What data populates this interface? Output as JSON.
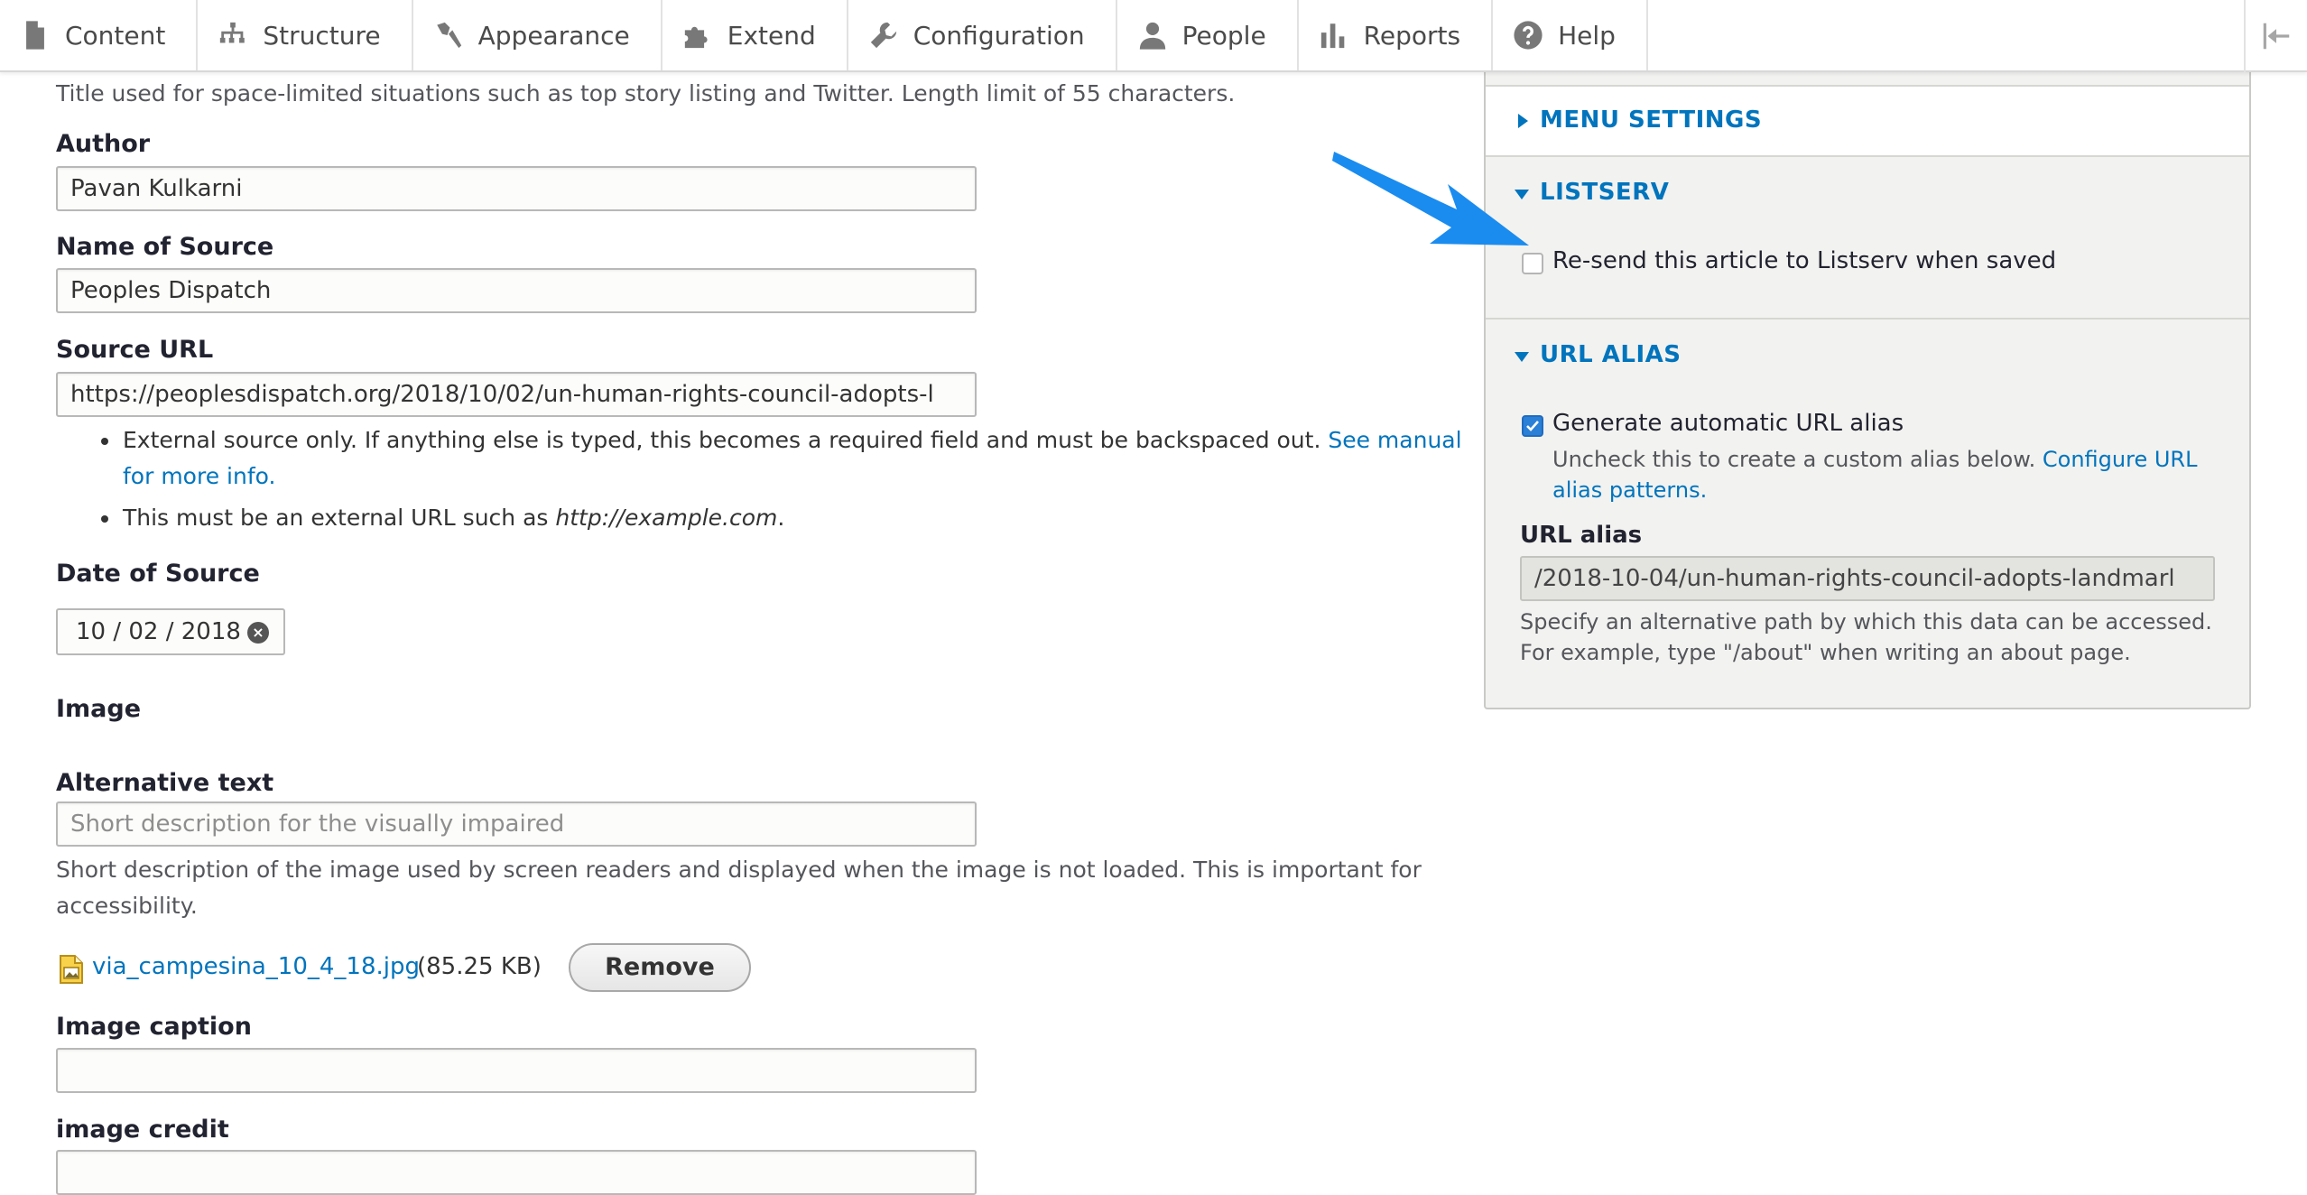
{
  "toolbar": {
    "items": [
      {
        "label": "Content",
        "icon": "document-icon"
      },
      {
        "label": "Structure",
        "icon": "sitemap-icon"
      },
      {
        "label": "Appearance",
        "icon": "paintbrush-icon"
      },
      {
        "label": "Extend",
        "icon": "puzzle-icon"
      },
      {
        "label": "Configuration",
        "icon": "wrench-icon"
      },
      {
        "label": "People",
        "icon": "person-icon"
      },
      {
        "label": "Reports",
        "icon": "bar-chart-icon"
      },
      {
        "label": "Help",
        "icon": "help-icon"
      }
    ]
  },
  "form": {
    "short_title_description": "Title used for space-limited situations such as top story listing and Twitter. Length limit of 55 characters.",
    "author": {
      "label": "Author",
      "value": "Pavan Kulkarni"
    },
    "source_name": {
      "label": "Name of Source",
      "value": "Peoples Dispatch"
    },
    "source_url": {
      "label": "Source URL",
      "value": "https://peoplesdispatch.org/2018/10/02/un-human-rights-council-adopts-l",
      "help_1_text": "External source only. If anything else is typed, this becomes a required field and must be backspaced out.",
      "help_1_link_a": "See manual",
      "help_1_link_b": "for more info.",
      "help_2_text": "This must be an external URL such as",
      "help_2_example": "http://example.com",
      "help_2_end": "."
    },
    "date_of_source": {
      "label": "Date of Source",
      "value": "10 / 02 / 2018"
    },
    "image": {
      "label": "Image",
      "alt_label": "Alternative text",
      "alt_placeholder": "Short description for the visually impaired",
      "alt_description_line1": "Short description of the image used by screen readers and displayed when the image is not loaded. This is important for",
      "alt_description_line2": "accessibility.",
      "file_name": "via_campesina_10_4_18.jpg",
      "file_size": "(85.25 KB)",
      "remove_label": "Remove"
    },
    "image_caption": {
      "label": "Image caption",
      "value": ""
    },
    "image_credit": {
      "label": "image credit"
    }
  },
  "sidebar": {
    "menu_settings": {
      "title": "MENU SETTINGS"
    },
    "listserv": {
      "title": "LISTSERV",
      "checkbox_label": "Re-send this article to Listserv when saved",
      "checked": false
    },
    "url_alias": {
      "title": "URL ALIAS",
      "auto_label": "Generate automatic URL alias",
      "auto_checked": true,
      "auto_desc": "Uncheck this to create a custom alias below.",
      "auto_link_a": "Configure URL",
      "auto_link_b": "alias patterns.",
      "alias_label": "URL alias",
      "alias_value": "/2018-10-04/un-human-rights-council-adopts-landmarl",
      "alias_desc_line1": "Specify an alternative path by which this data can be accessed.",
      "alias_desc_line2": "For example, type \"/about\" when writing an about page."
    }
  },
  "colors": {
    "link": "#0074bd",
    "arrow": "#1a8cf0",
    "checkbox": "#2a7fd6"
  }
}
